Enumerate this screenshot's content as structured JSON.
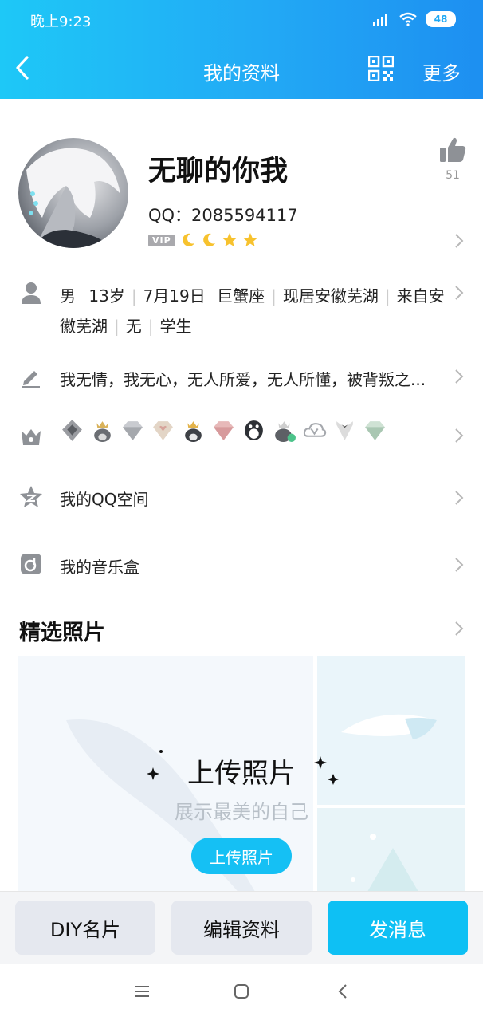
{
  "status": {
    "time": "晚上9:23",
    "battery": "48"
  },
  "header": {
    "title": "我的资料",
    "more": "更多"
  },
  "profile": {
    "nickname": "无聊的你我",
    "qq": "QQ：2085594117",
    "vip": "VIP",
    "like_count": "51"
  },
  "info": [
    "男",
    "13岁",
    "7月19日",
    "巨蟹座",
    "现居安徽芜湖",
    "来自安徽芜湖",
    "无",
    "学生"
  ],
  "signature": "我无情，我无心，无人所爱，无人所懂，被背叛之...",
  "links": {
    "qzone": "我的QQ空间",
    "music": "我的音乐盒"
  },
  "photos": {
    "section_title": "精选照片",
    "upload_title": "上传照片",
    "upload_subtitle": "展示最美的自己",
    "upload_button": "上传照片"
  },
  "actions": {
    "diy": "DIY名片",
    "edit": "编辑资料",
    "message": "发消息"
  },
  "colors": {
    "accent": "#0ec0f4",
    "header_start": "#1ec8f7",
    "header_end": "#1d8ff1"
  }
}
